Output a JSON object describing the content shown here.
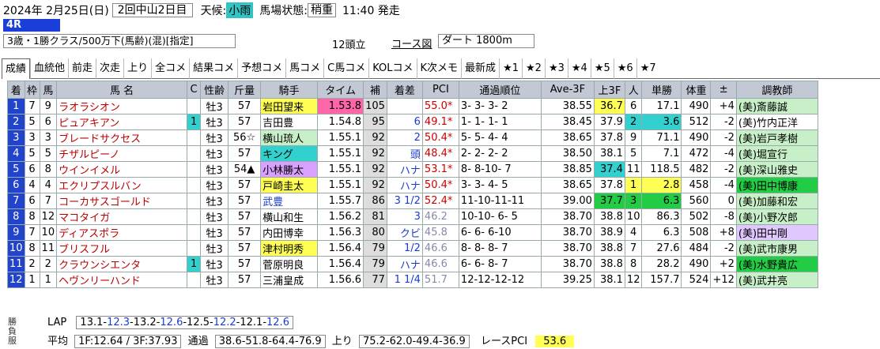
{
  "header": {
    "date": "2024年 2月25日(日)",
    "meeting": "2回中山2日目",
    "weather_label": "天候:",
    "weather": "小雨",
    "track_label": "馬場状態:",
    "track": "稍重",
    "time": "11:40 発走"
  },
  "race": {
    "number": "4R",
    "class": "3歳・1勝クラス/500万下(馬齢)(混)[指定]",
    "runners": "12頭立",
    "course_link": "コース図",
    "distance": "ダート 1800m"
  },
  "tabs": [
    "成績",
    "血統他",
    "前走",
    "次走",
    "上り",
    "全コメ",
    "結果コメ",
    "予想コメ",
    "馬コメ",
    "C馬コメ",
    "KOLコメ",
    "K次メモ",
    "最新成",
    "★1",
    "★2",
    "★3",
    "★4",
    "★5",
    "★6",
    "★7"
  ],
  "columns": [
    "着",
    "枠",
    "馬",
    "馬 名",
    "C",
    "性齢",
    "斤量",
    "騎手",
    "タイム",
    "補",
    "着差",
    "PCI",
    "通過順位",
    "Ave-3F",
    "上3F",
    "人",
    "単勝",
    "体重",
    "±",
    "調教師"
  ],
  "rows": [
    [
      "1",
      "7",
      "9",
      "ラオラシオン",
      "",
      "牡3",
      "57",
      "岩田望来",
      "1.53.8",
      "105",
      "",
      "55.0*",
      "3- 3- 3- 2",
      "38.55",
      "36.7",
      "6",
      "17.1",
      "490",
      "+4",
      "(美)斎藤誠"
    ],
    [
      "2",
      "5",
      "6",
      "ピュアキアン",
      "1",
      "牡3",
      "57",
      "吉田豊",
      "1.54.8",
      "95",
      "6",
      "49.1*",
      "1- 1- 1- 1",
      "38.45",
      "37.9",
      "2",
      "3.6",
      "512",
      "-2",
      "(美)竹内正洋"
    ],
    [
      "3",
      "3",
      "3",
      "ブレードサクセス",
      "",
      "牡3",
      "56☆",
      "横山琉人",
      "1.55.1",
      "92",
      "2",
      "50.4*",
      "5- 5- 4- 4",
      "38.65",
      "37.8",
      "9",
      "71.1",
      "490",
      "-2",
      "(美)岩戸孝樹"
    ],
    [
      "4",
      "5",
      "5",
      "チザルピーノ",
      "",
      "牡3",
      "57",
      "キング",
      "1.55.1",
      "92",
      "頭",
      "48.4*",
      "2- 2- 2- 2",
      "38.50",
      "38.1",
      "5",
      "7.1",
      "472",
      "-4",
      "(美)堀宣行"
    ],
    [
      "5",
      "6",
      "8",
      "ウインイメル",
      "",
      "牡3",
      "54▲",
      "小林勝太",
      "1.55.1",
      "92",
      "ハナ",
      "53.1*",
      "8- 8-10- 7",
      "38.85",
      "37.4",
      "11",
      "118.5",
      "482",
      "-2",
      "(美)深山雅史"
    ],
    [
      "6",
      "4",
      "4",
      "エクリプスルバン",
      "",
      "牡3",
      "57",
      "戸崎圭太",
      "1.55.1",
      "92",
      "ハナ",
      "50.4*",
      "3- 3- 4- 5",
      "38.65",
      "37.8",
      "1",
      "2.8",
      "458",
      "-4",
      "(美)田中博康"
    ],
    [
      "7",
      "6",
      "7",
      "コーカサスゴールド",
      "",
      "牡3",
      "57",
      "武豊",
      "1.55.7",
      "86",
      "3 1/2",
      "52.4*",
      "11-10-11-11",
      "39.00",
      "37.7",
      "3",
      "6.3",
      "560",
      "0",
      "(美)加藤和宏"
    ],
    [
      "8",
      "8",
      "12",
      "マコタイガ",
      "",
      "牡3",
      "57",
      "横山和生",
      "1.56.2",
      "81",
      "3",
      "46.2",
      "10-10- 6- 5",
      "38.70",
      "38.8",
      "10",
      "86.3",
      "502",
      "-8",
      "(美)小野次郎"
    ],
    [
      "9",
      "7",
      "10",
      "ディアスポラ",
      "",
      "牡3",
      "57",
      "内田博幸",
      "1.56.3",
      "80",
      "クビ",
      "45.8",
      "6- 6- 6-10",
      "38.70",
      "38.9",
      "4",
      "6.3",
      "508",
      "+8",
      "(美)田中剛"
    ],
    [
      "10",
      "8",
      "11",
      "ブリスフル",
      "",
      "牡3",
      "57",
      "津村明秀",
      "1.56.4",
      "79",
      "1/2",
      "46.6",
      "8- 8- 8- 7",
      "38.70",
      "38.8",
      "7",
      "27.6",
      "484",
      "-2",
      "(美)武市康男"
    ],
    [
      "11",
      "2",
      "2",
      "クラウンシエンタ",
      "1",
      "牡3",
      "57",
      "菅原明良",
      "1.56.4",
      "79",
      "ハナ",
      "46.6",
      "6- 6- 8- 7",
      "38.70",
      "38.8",
      "8",
      "28.2",
      "490",
      "+2",
      "(美)水野貴広"
    ],
    [
      "12",
      "1",
      "1",
      "ヘヴンリーハンド",
      "",
      "牡3",
      "57",
      "三浦皇成",
      "1.56.6",
      "77",
      "1 1/4",
      "51.7",
      "12-12-12-12",
      "39.25",
      "38.1",
      "12",
      "157.7",
      "524",
      "+12",
      "(美)武井亮"
    ]
  ],
  "footer": {
    "side_label": "勝負服",
    "lap_label": "LAP",
    "laps": [
      "13.1",
      "12.3",
      "13.2",
      "12.6",
      "12.5",
      "12.2",
      "12.1",
      "12.6"
    ],
    "avg_label": "平均",
    "avg": "1F:12.64 / 3F:37.93",
    "pass_label": "通過",
    "pass": "38.6-51.8-64.4-76.9",
    "up_label": "上り",
    "up": "75.2-62.0-49.4-36.9",
    "pci_label": "レースPCI",
    "pci": "53.6"
  }
}
